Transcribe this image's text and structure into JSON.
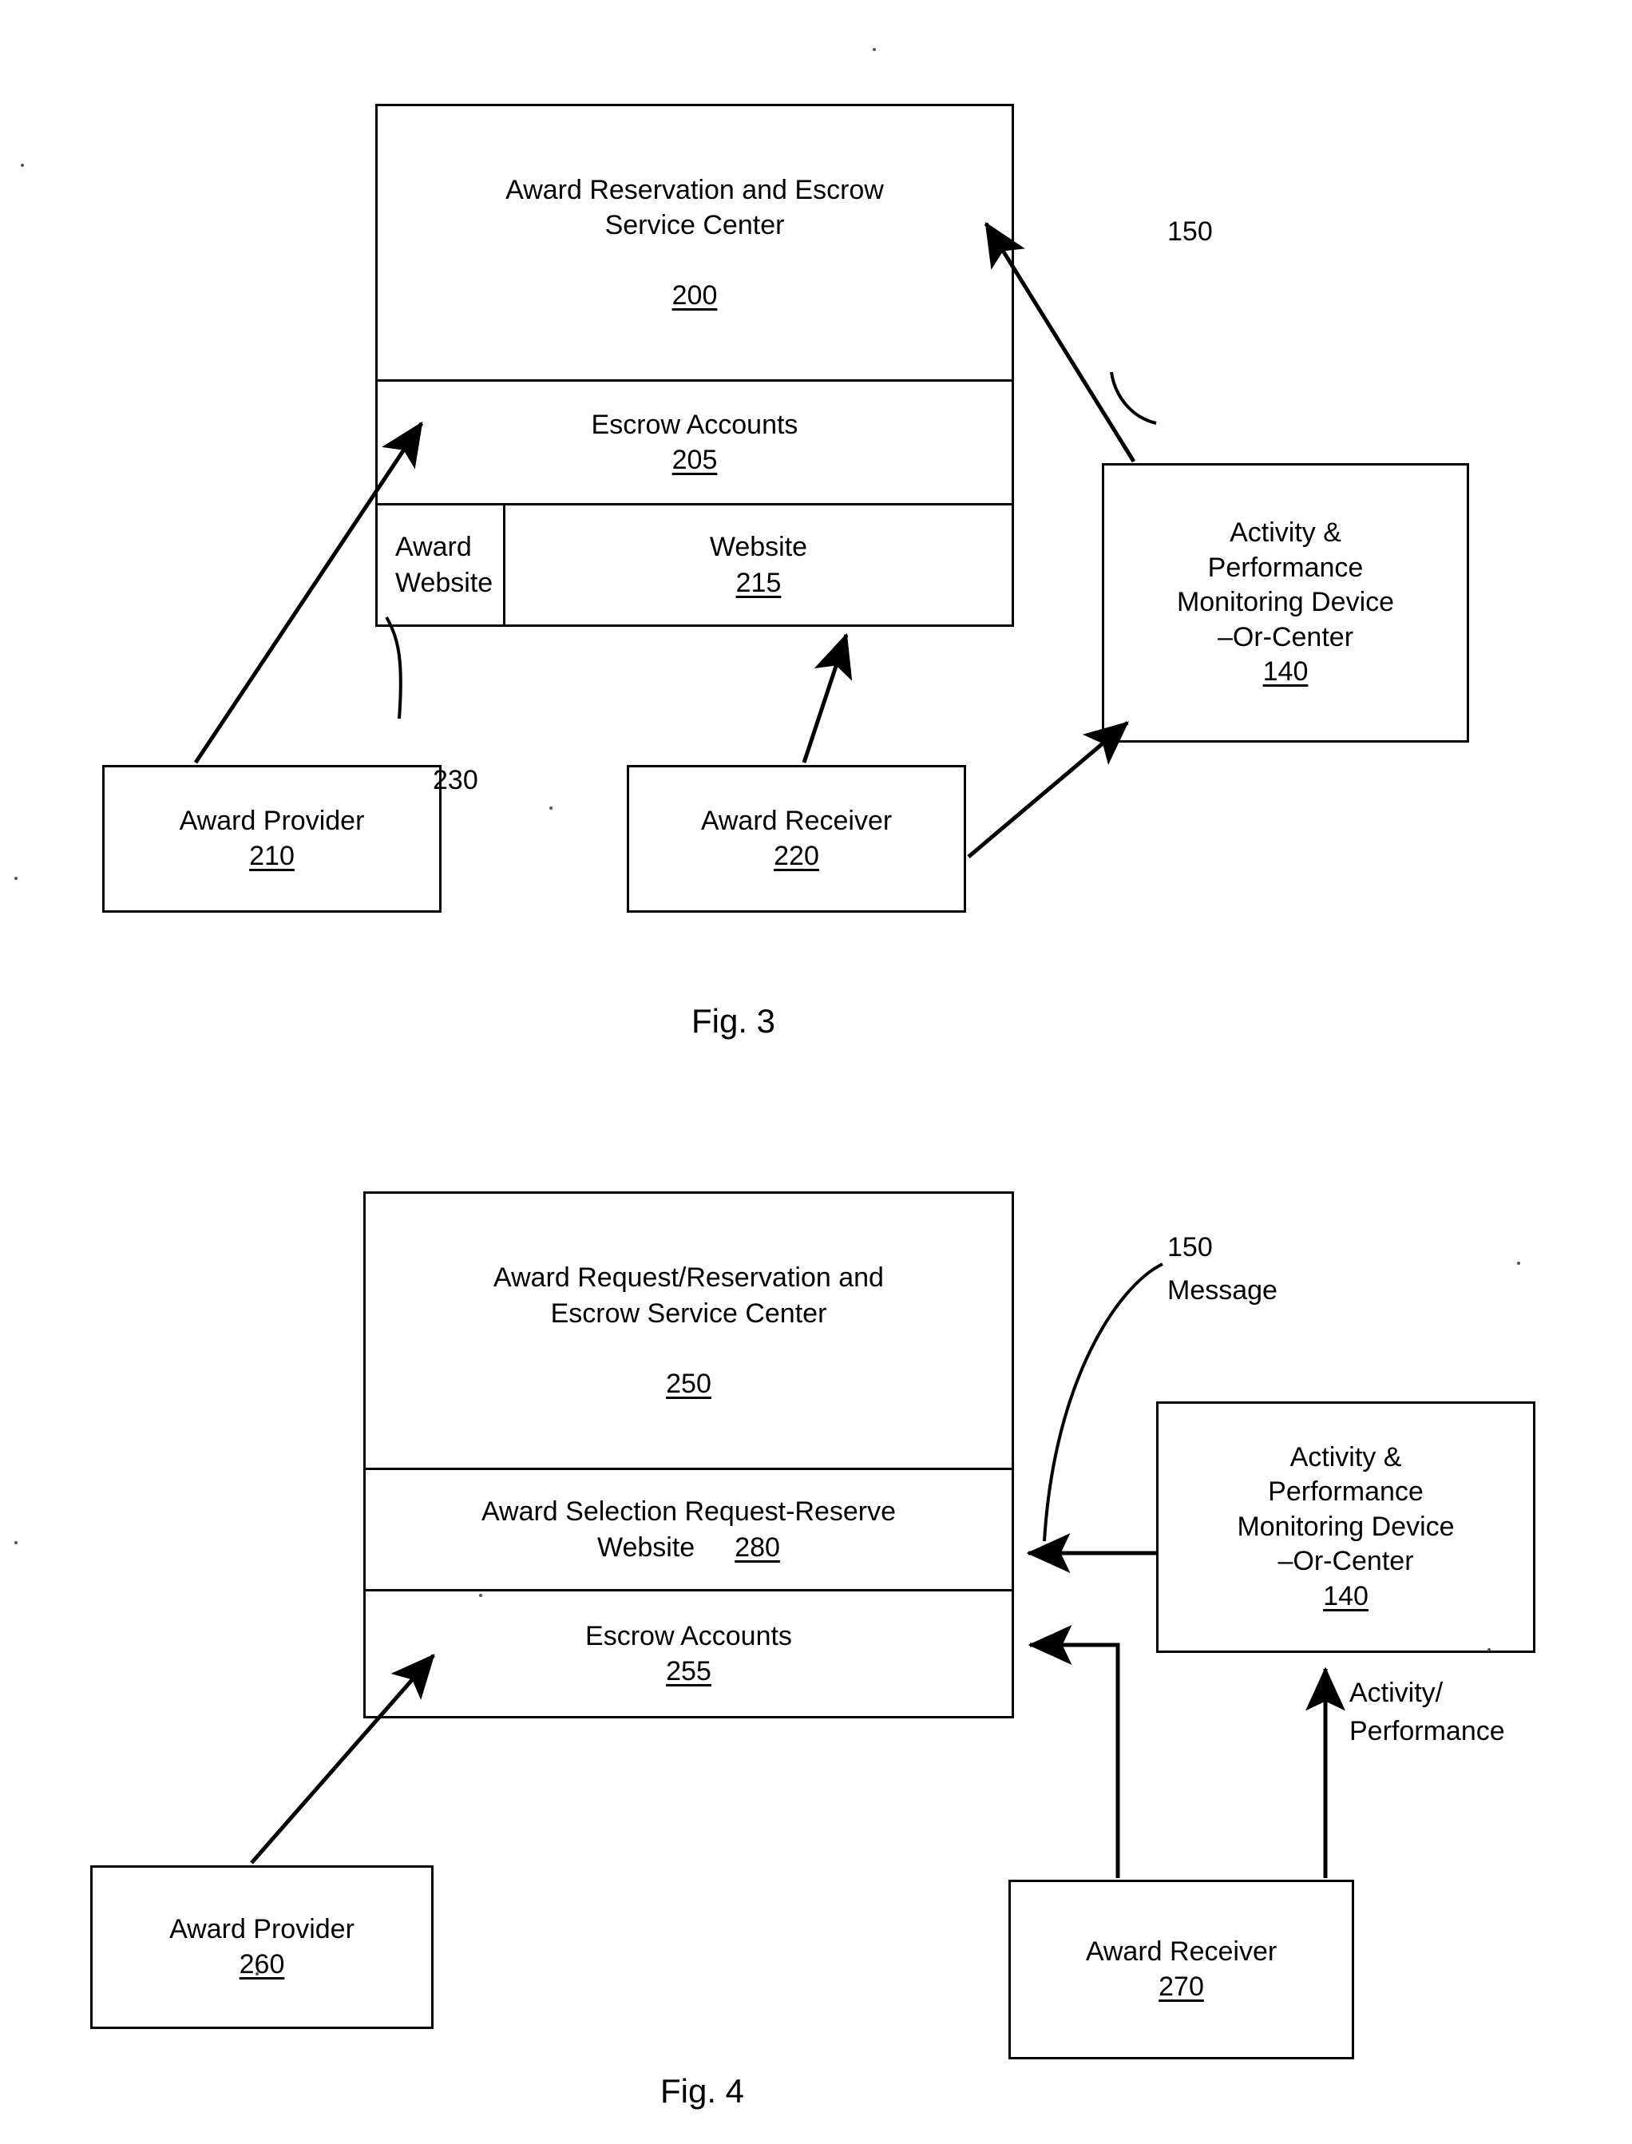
{
  "document": {
    "type": "patent-drawing-sheet",
    "figures": [
      {
        "id": "fig3",
        "caption": "Fig. 3",
        "service_center": {
          "title_line1": "Award Reservation and Escrow",
          "title_line2": "Service Center",
          "ref": "200",
          "escrow": {
            "label": "Escrow Accounts",
            "ref": "205"
          },
          "sub_left": {
            "line1": "Award",
            "line2": "Website"
          },
          "sub_right": {
            "label": "Website",
            "ref": "215"
          }
        },
        "monitor": {
          "line1": "Activity &",
          "line2": "Performance",
          "line3": "Monitoring Device",
          "line4": "–Or-Center",
          "ref": "140"
        },
        "provider": {
          "label": "Award Provider",
          "ref": "210"
        },
        "receiver": {
          "label": "Award Receiver",
          "ref": "220"
        },
        "callout_150": "150",
        "callout_230": "230"
      },
      {
        "id": "fig4",
        "caption": "Fig. 4",
        "service_center": {
          "title_line1": "Award Request/Reservation and",
          "title_line2": "Escrow Service Center",
          "ref": "250",
          "selection": {
            "line1": "Award Selection Request-Reserve",
            "line2_label": "Website",
            "line2_ref": "280"
          },
          "escrow": {
            "label": "Escrow Accounts",
            "ref": "255"
          }
        },
        "monitor": {
          "line1": "Activity &",
          "line2": "Performance",
          "line3": "Monitoring Device",
          "line4": "–Or-Center",
          "ref": "140"
        },
        "provider": {
          "label": "Award Provider",
          "ref": "260"
        },
        "receiver": {
          "label": "Award Receiver",
          "ref": "270"
        },
        "callout_150": "150",
        "callout_message": "Message",
        "callout_activity_line1": "Activity/",
        "callout_activity_line2": "Performance"
      }
    ],
    "colors": {
      "ink": "#000000",
      "paper": "#ffffff"
    }
  }
}
